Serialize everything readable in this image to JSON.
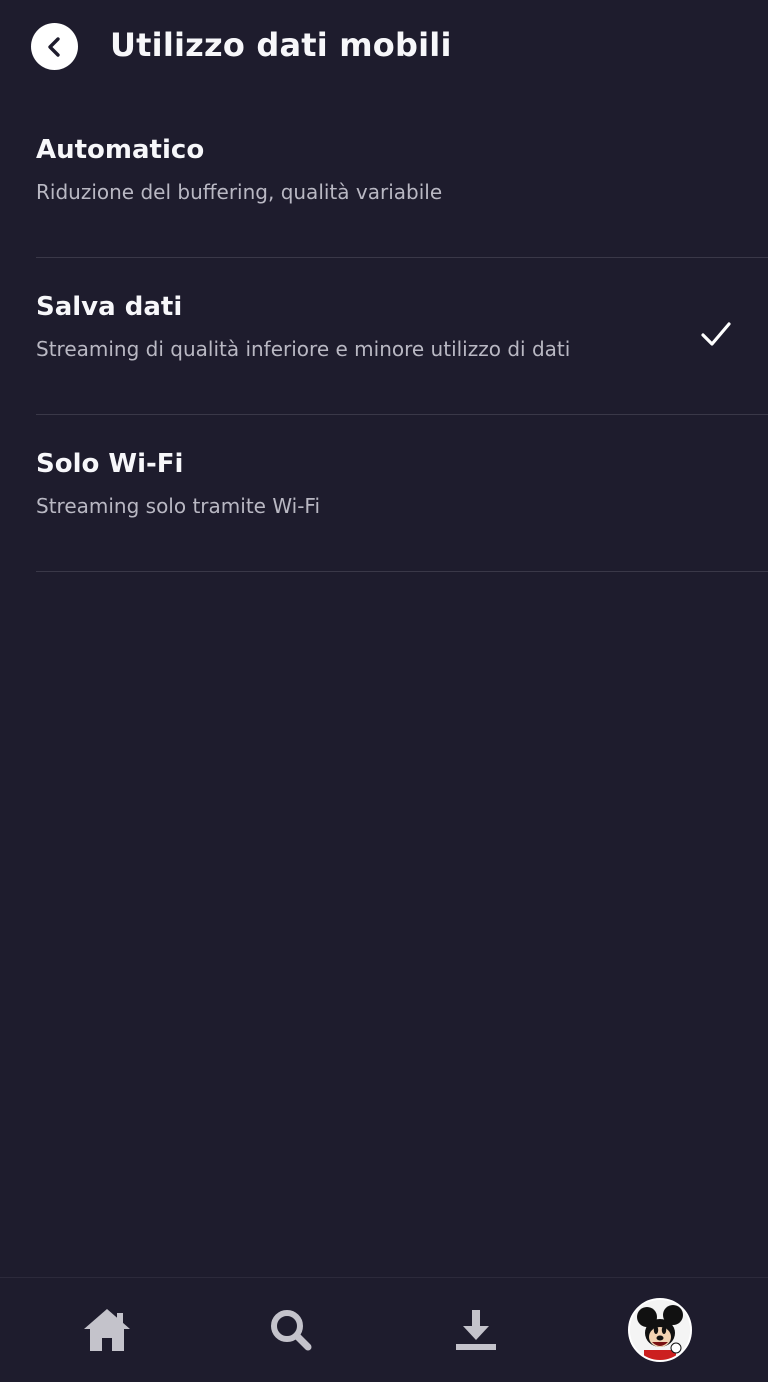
{
  "header": {
    "title": "Utilizzo dati mobili",
    "back_icon": "chevron-left-icon"
  },
  "options": [
    {
      "title": "Automatico",
      "subtitle": "Riduzione del buffering, qualità variabile",
      "selected": false
    },
    {
      "title": "Salva dati",
      "subtitle": "Streaming di qualità inferiore e minore utilizzo di dati",
      "selected": true
    },
    {
      "title": "Solo Wi-Fi",
      "subtitle": "Streaming solo tramite Wi-Fi",
      "selected": false
    }
  ],
  "bottom_nav": {
    "items": [
      {
        "icon": "home-icon"
      },
      {
        "icon": "search-icon"
      },
      {
        "icon": "download-icon"
      },
      {
        "icon": "profile-avatar"
      }
    ]
  },
  "colors": {
    "background": "#1e1c2d",
    "text_primary": "#f7f7fa",
    "text_secondary": "#b9b8c3",
    "divider": "#3a3848",
    "icon_gray": "#bdbdc4"
  }
}
